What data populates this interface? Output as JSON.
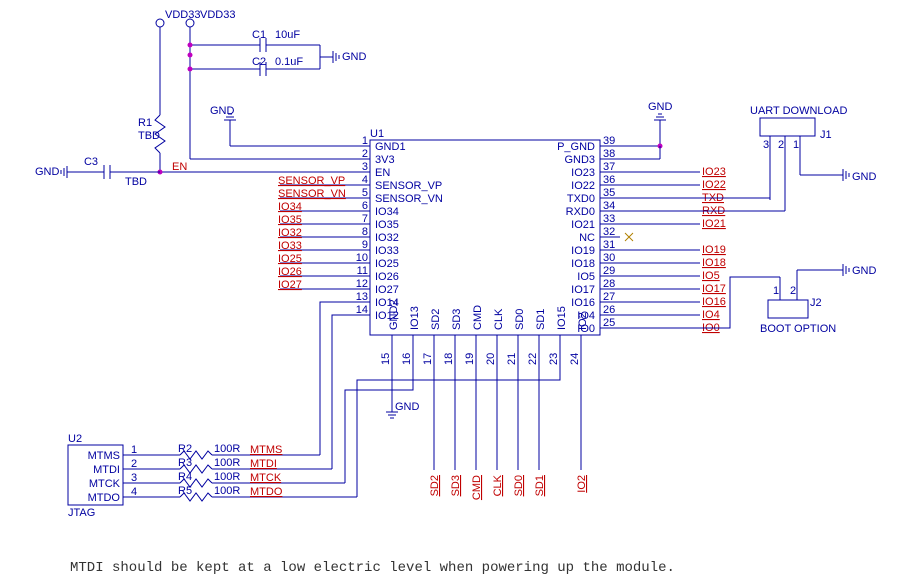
{
  "power": {
    "vdd_a": "VDD33",
    "vdd_b": "VDD33"
  },
  "caps": {
    "c1_ref": "C1",
    "c1_val": "10uF",
    "c2_ref": "C2",
    "c2_val": "0.1uF",
    "c3_ref": "C3",
    "c3_val": "TBD"
  },
  "res": {
    "r1_ref": "R1",
    "r1_val": "TBD",
    "r2": {
      "ref": "R2",
      "val": "100R"
    },
    "r3": {
      "ref": "R3",
      "val": "100R"
    },
    "r4": {
      "ref": "R4",
      "val": "100R"
    },
    "r5": {
      "ref": "R5",
      "val": "100R"
    }
  },
  "gnd": "GND",
  "u1": {
    "ref": "U1",
    "left_pins": [
      {
        "n": "1",
        "name": "GND1"
      },
      {
        "n": "2",
        "name": "3V3"
      },
      {
        "n": "3",
        "name": "EN"
      },
      {
        "n": "4",
        "name": "SENSOR_VP"
      },
      {
        "n": "5",
        "name": "SENSOR_VN"
      },
      {
        "n": "6",
        "name": "IO34"
      },
      {
        "n": "7",
        "name": "IO35"
      },
      {
        "n": "8",
        "name": "IO32"
      },
      {
        "n": "9",
        "name": "IO33"
      },
      {
        "n": "10",
        "name": "IO25"
      },
      {
        "n": "11",
        "name": "IO26"
      },
      {
        "n": "12",
        "name": "IO27"
      },
      {
        "n": "13",
        "name": "IO14"
      },
      {
        "n": "14",
        "name": "IO12"
      }
    ],
    "right_pins": [
      {
        "n": "39",
        "name": "P_GND"
      },
      {
        "n": "38",
        "name": "GND3"
      },
      {
        "n": "37",
        "name": "IO23"
      },
      {
        "n": "36",
        "name": "IO22"
      },
      {
        "n": "35",
        "name": "TXD0"
      },
      {
        "n": "34",
        "name": "RXD0"
      },
      {
        "n": "33",
        "name": "IO21"
      },
      {
        "n": "32",
        "name": "NC"
      },
      {
        "n": "31",
        "name": "IO19"
      },
      {
        "n": "30",
        "name": "IO18"
      },
      {
        "n": "29",
        "name": "IO5"
      },
      {
        "n": "28",
        "name": "IO17"
      },
      {
        "n": "27",
        "name": "IO16"
      },
      {
        "n": "26",
        "name": "IO4"
      },
      {
        "n": "25",
        "name": "IO0"
      }
    ],
    "bottom_pins": [
      {
        "n": "15",
        "name": "GND2"
      },
      {
        "n": "16",
        "name": "IO13"
      },
      {
        "n": "17",
        "name": "SD2"
      },
      {
        "n": "18",
        "name": "SD3"
      },
      {
        "n": "19",
        "name": "CMD"
      },
      {
        "n": "20",
        "name": "CLK"
      },
      {
        "n": "21",
        "name": "SD0"
      },
      {
        "n": "22",
        "name": "SD1"
      },
      {
        "n": "23",
        "name": "IO15"
      },
      {
        "n": "24",
        "name": "IO2"
      }
    ]
  },
  "nets": {
    "en": "EN",
    "sensor_vp": "SENSOR_VP",
    "sensor_vn": "SENSOR_VN",
    "io34": "IO34",
    "io35": "IO35",
    "io32": "IO32",
    "io33": "IO33",
    "io25": "IO25",
    "io26": "IO26",
    "io27": "IO27",
    "io23": "IO23",
    "io22": "IO22",
    "txd": "TXD",
    "rxd": "RXD",
    "io21": "IO21",
    "io19": "IO19",
    "io18": "IO18",
    "io5": "IO5",
    "io17": "IO17",
    "io16": "IO16",
    "io4": "IO4",
    "io0": "IO0",
    "sd2": "SD2",
    "sd3": "SD3",
    "cmd": "CMD",
    "clk": "CLK",
    "sd0": "SD0",
    "sd1": "SD1",
    "io2": "IO2",
    "mtms": "MTMS",
    "mtdi": "MTDI",
    "mtck": "MTCK",
    "mtdo": "MTDO"
  },
  "u2": {
    "ref": "U2",
    "pins": [
      "MTMS",
      "MTDI",
      "MTCK",
      "MTDO"
    ],
    "name": "JTAG"
  },
  "j1": {
    "ref": "J1",
    "name": "UART DOWNLOAD"
  },
  "j2": {
    "ref": "J2",
    "name": "BOOT OPTION"
  },
  "footnote": "MTDI should be kept at a low electric level when powering up the module."
}
